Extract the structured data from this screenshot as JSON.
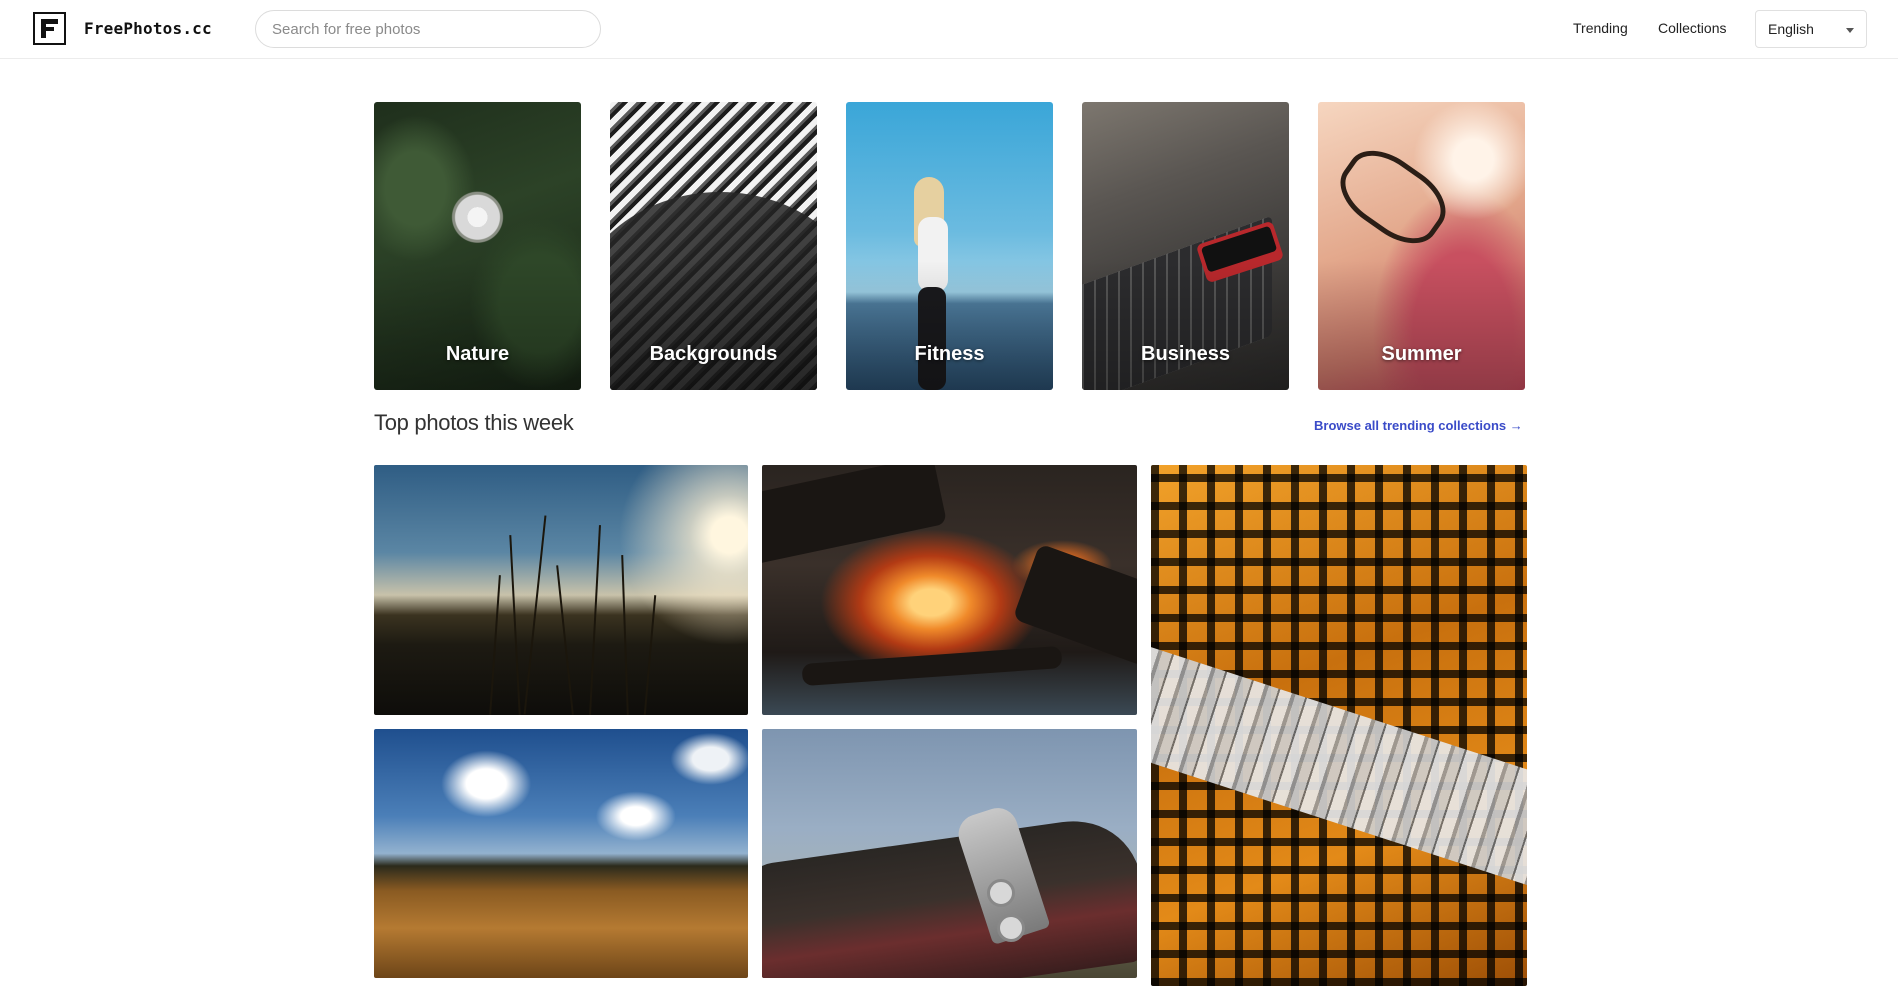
{
  "header": {
    "site_name": "FreePhotos.cc",
    "search_placeholder": "Search for free photos",
    "nav": [
      "Trending",
      "Collections"
    ],
    "language": "English"
  },
  "categories": [
    {
      "label": "Nature"
    },
    {
      "label": "Backgrounds"
    },
    {
      "label": "Fitness"
    },
    {
      "label": "Business"
    },
    {
      "label": "Summer"
    }
  ],
  "section": {
    "title": "Top photos this week",
    "browse_link": "Browse all trending collections →"
  },
  "colors": {
    "link": "#3a4bc8",
    "text": "#333333",
    "border": "#dcdcdc"
  }
}
